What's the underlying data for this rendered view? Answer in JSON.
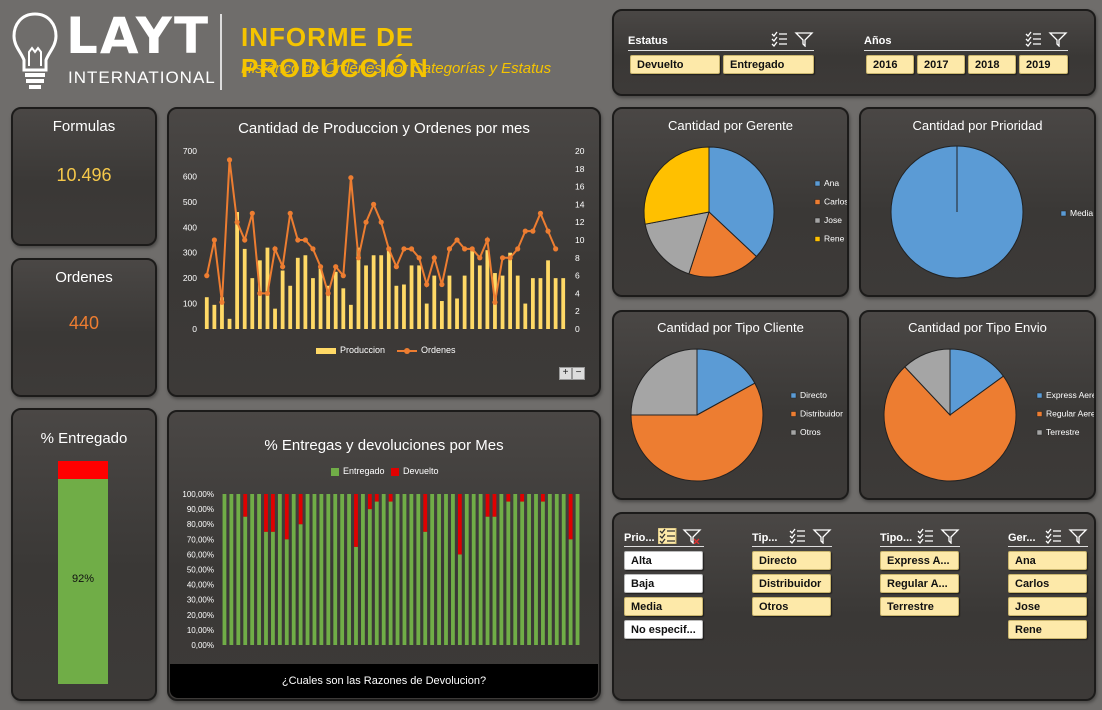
{
  "header": {
    "logo_text": "LAYT",
    "logo_sub": "INTERNATIONAL",
    "title": "INFORME DE PRODUCCIÓN",
    "subtitle": "Histórico de Órdenes por Categorías y Estatus"
  },
  "filters_top": {
    "estatus": {
      "label": "Estatus",
      "items": [
        "Devuelto",
        "Entregado"
      ]
    },
    "anos": {
      "label": "Años",
      "items": [
        "2016",
        "2017",
        "2018",
        "2019"
      ]
    }
  },
  "kpis": {
    "formulas": {
      "label": "Formulas",
      "value": "10.496",
      "color": "#f5c84a"
    },
    "ordenes": {
      "label": "Ordenes",
      "value": "440",
      "color": "#ed7d31"
    },
    "entregado": {
      "label": "% Entregado",
      "value": "92%",
      "fraction": 0.92,
      "fill": "#70ad47",
      "rest": "#ff0000"
    }
  },
  "chart_prod": {
    "title": "Cantidad  de Produccion y Ordenes por mes",
    "legend": {
      "bar": "Produccion",
      "line": "Ordenes"
    },
    "zoom_plus": "+",
    "zoom_minus": "−"
  },
  "chart_entregas": {
    "title": "% Entregas y devoluciones por Mes",
    "legend": {
      "a": "Entregado",
      "b": "Devuelto"
    },
    "footer": "¿Cuales son las Razones de Devolucion?"
  },
  "pies": {
    "gerente": {
      "title": "Cantidad por Gerente",
      "labels": [
        "Ana",
        "Carlos",
        "Jose",
        "Rene"
      ]
    },
    "prioridad": {
      "title": "Cantidad por Prioridad",
      "labels": [
        "Media"
      ]
    },
    "tipo_cliente": {
      "title": "Cantidad por Tipo Cliente",
      "labels": [
        "Directo",
        "Distribuidor",
        "Otros"
      ]
    },
    "tipo_envio": {
      "title": "Cantidad por Tipo Envio",
      "labels": [
        "Express Aereo",
        "Regular Aereo",
        "Terrestre"
      ]
    }
  },
  "slicers": {
    "prioridad": {
      "label": "Prio...",
      "items": [
        "Alta",
        "Baja",
        "Media",
        "No especif..."
      ]
    },
    "tipo_cliente": {
      "label": "Tip...",
      "items": [
        "Directo",
        "Distribuidor",
        "Otros"
      ]
    },
    "tipo_envio": {
      "label": "Tipo...",
      "items": [
        "Express A...",
        "Regular A...",
        "Terrestre"
      ]
    },
    "gerente": {
      "label": "Ger...",
      "items": [
        "Ana",
        "Carlos",
        "Jose",
        "Rene"
      ]
    }
  },
  "colors": {
    "blue": "#5b9bd5",
    "orange": "#ed7d31",
    "gray": "#a5a5a5",
    "gold": "#ffc000",
    "bar": "#ffd966",
    "green": "#70ad47",
    "red": "#e00000"
  },
  "chart_data": [
    {
      "type": "bar",
      "title": "Cantidad  de Produccion y Ordenes por mes",
      "ylim": [
        0,
        700
      ],
      "y2lim": [
        0,
        20
      ],
      "series": [
        {
          "name": "Produccion",
          "type": "bar",
          "axis": "left",
          "values": [
            125,
            95,
            125,
            40,
            460,
            315,
            200,
            270,
            320,
            80,
            230,
            170,
            280,
            290,
            200,
            250,
            170,
            225,
            160,
            95,
            320,
            250,
            290,
            290,
            310,
            170,
            175,
            250,
            250,
            100,
            210,
            110,
            210,
            120,
            210,
            310,
            250,
            310,
            220,
            210,
            300,
            210,
            100,
            200,
            200,
            270,
            200,
            200
          ]
        },
        {
          "name": "Ordenes",
          "type": "line",
          "axis": "right",
          "values": [
            6,
            10,
            3,
            19,
            12,
            10,
            13,
            4,
            4,
            9,
            7,
            13,
            10,
            10,
            9,
            7,
            4,
            7,
            6,
            17,
            8,
            12,
            14,
            12,
            9,
            7,
            9,
            9,
            8,
            5,
            8,
            5,
            9,
            10,
            9,
            9,
            8,
            10,
            3,
            8,
            8,
            9,
            11,
            11,
            13,
            11,
            9
          ]
        }
      ]
    },
    {
      "type": "bar",
      "title": "% Entregas y devoluciones por Mes",
      "ylim": [
        0,
        100
      ],
      "series": [
        {
          "name": "Entregado",
          "values": [
            100,
            100,
            100,
            85,
            100,
            100,
            75,
            75,
            100,
            70,
            100,
            80,
            100,
            100,
            100,
            100,
            100,
            100,
            100,
            65,
            100,
            90,
            95,
            100,
            95,
            100,
            100,
            100,
            100,
            75,
            100,
            100,
            100,
            100,
            60,
            100,
            100,
            100,
            85,
            85,
            100,
            95,
            100,
            95,
            100,
            100,
            95,
            100,
            100,
            100,
            70,
            100
          ]
        },
        {
          "name": "Devuelto",
          "values": [
            0,
            0,
            0,
            15,
            0,
            0,
            25,
            25,
            0,
            30,
            0,
            20,
            0,
            0,
            0,
            0,
            0,
            0,
            0,
            35,
            0,
            10,
            5,
            0,
            5,
            0,
            0,
            0,
            0,
            25,
            0,
            0,
            0,
            0,
            40,
            0,
            0,
            0,
            15,
            15,
            0,
            5,
            0,
            5,
            0,
            0,
            5,
            0,
            0,
            0,
            30,
            0
          ]
        }
      ]
    },
    {
      "type": "pie",
      "title": "Cantidad por Gerente",
      "labels": [
        "Ana",
        "Carlos",
        "Jose",
        "Rene"
      ],
      "values": [
        37,
        18,
        17,
        28
      ]
    },
    {
      "type": "pie",
      "title": "Cantidad por Prioridad",
      "labels": [
        "Media"
      ],
      "values": [
        100
      ]
    },
    {
      "type": "pie",
      "title": "Cantidad por Tipo Cliente",
      "labels": [
        "Directo",
        "Distribuidor",
        "Otros"
      ],
      "values": [
        17,
        58,
        25
      ]
    },
    {
      "type": "pie",
      "title": "Cantidad por Tipo Envio",
      "labels": [
        "Express Aereo",
        "Regular Aereo",
        "Terrestre"
      ],
      "values": [
        15,
        73,
        12
      ]
    }
  ]
}
